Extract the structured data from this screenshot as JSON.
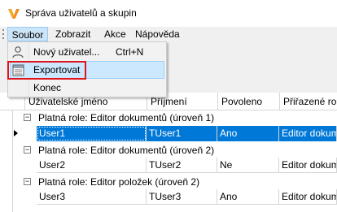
{
  "window": {
    "title": "Správa uživatelů a skupin"
  },
  "menubar": {
    "items": [
      "Soubor",
      "Zobrazit",
      "Akce",
      "Nápověda"
    ]
  },
  "file_menu": {
    "items": [
      {
        "label": "Nový uživatel...",
        "shortcut": "Ctrl+N",
        "icon": "user-icon"
      },
      {
        "label": "Exportovat",
        "shortcut": "",
        "icon": "export-icon"
      },
      {
        "label": "Konec",
        "shortcut": "",
        "icon": ""
      }
    ],
    "highlight_color": "#e0141c"
  },
  "grid": {
    "columns": [
      "Uživatelské jméno",
      "Příjmení",
      "Povoleno",
      "Přiřazené role"
    ],
    "groups": [
      {
        "label": "Platná role: Editor dokumentů (úroveň 1)",
        "rows": [
          [
            "User1",
            "TUser1",
            "Ano",
            "Editor dokum"
          ]
        ]
      },
      {
        "label": "Platná role: Editor dokumentů (úroveň 2)",
        "rows": [
          [
            "User2",
            "TUser2",
            "Ne",
            "Editor dokum"
          ]
        ]
      },
      {
        "label": "Platná role: Editor položek (úroveň 2)",
        "rows": [
          [
            "User3",
            "TUser3",
            "Ano",
            "Editor dokum"
          ]
        ]
      }
    ],
    "selected_color": "#0078d7"
  }
}
